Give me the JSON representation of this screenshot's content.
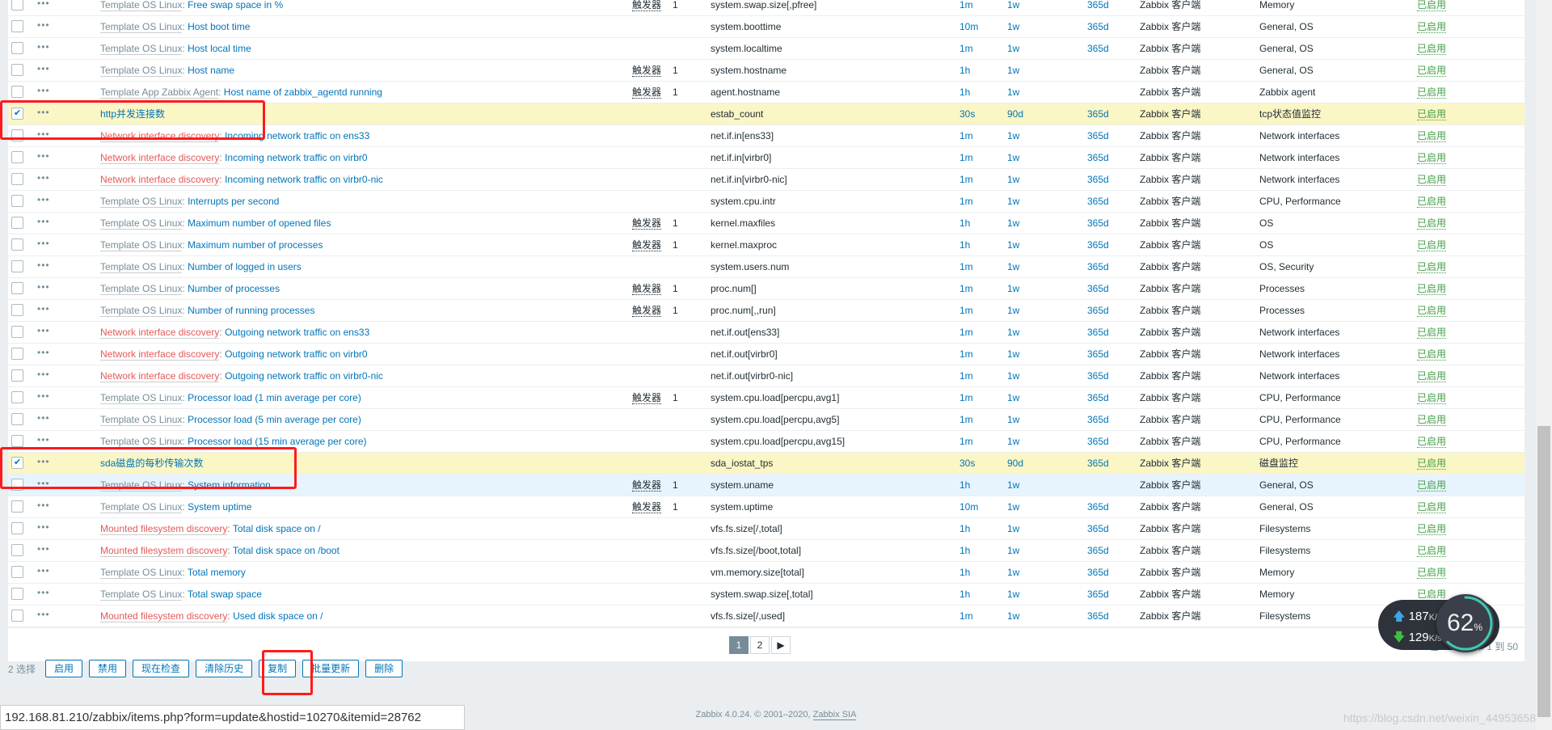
{
  "trigger_label": "触发器",
  "rows": [
    {
      "prefix": "Template OS Linux",
      "prefix_color": "gray",
      "name": "Free swap space in %",
      "triggers": "1",
      "key": "system.swap.size[,pfree]",
      "interval": "1m",
      "history": "1w",
      "trends": "365d",
      "type": "Zabbix 客户端",
      "apps": "Memory",
      "status": "已启用"
    },
    {
      "prefix": "Template OS Linux",
      "prefix_color": "gray",
      "name": "Host boot time",
      "triggers": "",
      "key": "system.boottime",
      "interval": "10m",
      "history": "1w",
      "trends": "365d",
      "type": "Zabbix 客户端",
      "apps": "General, OS",
      "status": "已启用"
    },
    {
      "prefix": "Template OS Linux",
      "prefix_color": "gray",
      "name": "Host local time",
      "triggers": "",
      "key": "system.localtime",
      "interval": "1m",
      "history": "1w",
      "trends": "365d",
      "type": "Zabbix 客户端",
      "apps": "General, OS",
      "status": "已启用"
    },
    {
      "prefix": "Template OS Linux",
      "prefix_color": "gray",
      "name": "Host name",
      "triggers": "1",
      "key": "system.hostname",
      "interval": "1h",
      "history": "1w",
      "trends": "",
      "type": "Zabbix 客户端",
      "apps": "General, OS",
      "status": "已启用"
    },
    {
      "prefix": "Template App Zabbix Agent",
      "prefix_color": "gray",
      "name": "Host name of zabbix_agentd running",
      "triggers": "1",
      "key": "agent.hostname",
      "interval": "1h",
      "history": "1w",
      "trends": "",
      "type": "Zabbix 客户端",
      "apps": "Zabbix agent",
      "status": "已启用"
    },
    {
      "prefix": "",
      "prefix_color": "",
      "name": "http并发连接数",
      "triggers": "",
      "key": "estab_count",
      "interval": "30s",
      "history": "90d",
      "trends": "365d",
      "type": "Zabbix 客户端",
      "apps": "tcp状态值监控",
      "status": "已启用",
      "checked": true
    },
    {
      "prefix": "Network interface discovery",
      "prefix_color": "red",
      "name": "Incoming network traffic on ens33",
      "triggers": "",
      "key": "net.if.in[ens33]",
      "interval": "1m",
      "history": "1w",
      "trends": "365d",
      "type": "Zabbix 客户端",
      "apps": "Network interfaces",
      "status": "已启用"
    },
    {
      "prefix": "Network interface discovery",
      "prefix_color": "red",
      "name": "Incoming network traffic on virbr0",
      "triggers": "",
      "key": "net.if.in[virbr0]",
      "interval": "1m",
      "history": "1w",
      "trends": "365d",
      "type": "Zabbix 客户端",
      "apps": "Network interfaces",
      "status": "已启用"
    },
    {
      "prefix": "Network interface discovery",
      "prefix_color": "red",
      "name": "Incoming network traffic on virbr0-nic",
      "triggers": "",
      "key": "net.if.in[virbr0-nic]",
      "interval": "1m",
      "history": "1w",
      "trends": "365d",
      "type": "Zabbix 客户端",
      "apps": "Network interfaces",
      "status": "已启用"
    },
    {
      "prefix": "Template OS Linux",
      "prefix_color": "gray",
      "name": "Interrupts per second",
      "triggers": "",
      "key": "system.cpu.intr",
      "interval": "1m",
      "history": "1w",
      "trends": "365d",
      "type": "Zabbix 客户端",
      "apps": "CPU, Performance",
      "status": "已启用"
    },
    {
      "prefix": "Template OS Linux",
      "prefix_color": "gray",
      "name": "Maximum number of opened files",
      "triggers": "1",
      "key": "kernel.maxfiles",
      "interval": "1h",
      "history": "1w",
      "trends": "365d",
      "type": "Zabbix 客户端",
      "apps": "OS",
      "status": "已启用"
    },
    {
      "prefix": "Template OS Linux",
      "prefix_color": "gray",
      "name": "Maximum number of processes",
      "triggers": "1",
      "key": "kernel.maxproc",
      "interval": "1h",
      "history": "1w",
      "trends": "365d",
      "type": "Zabbix 客户端",
      "apps": "OS",
      "status": "已启用"
    },
    {
      "prefix": "Template OS Linux",
      "prefix_color": "gray",
      "name": "Number of logged in users",
      "triggers": "",
      "key": "system.users.num",
      "interval": "1m",
      "history": "1w",
      "trends": "365d",
      "type": "Zabbix 客户端",
      "apps": "OS, Security",
      "status": "已启用"
    },
    {
      "prefix": "Template OS Linux",
      "prefix_color": "gray",
      "name": "Number of processes",
      "triggers": "1",
      "key": "proc.num[]",
      "interval": "1m",
      "history": "1w",
      "trends": "365d",
      "type": "Zabbix 客户端",
      "apps": "Processes",
      "status": "已启用"
    },
    {
      "prefix": "Template OS Linux",
      "prefix_color": "gray",
      "name": "Number of running processes",
      "triggers": "1",
      "key": "proc.num[,,run]",
      "interval": "1m",
      "history": "1w",
      "trends": "365d",
      "type": "Zabbix 客户端",
      "apps": "Processes",
      "status": "已启用"
    },
    {
      "prefix": "Network interface discovery",
      "prefix_color": "red",
      "name": "Outgoing network traffic on ens33",
      "triggers": "",
      "key": "net.if.out[ens33]",
      "interval": "1m",
      "history": "1w",
      "trends": "365d",
      "type": "Zabbix 客户端",
      "apps": "Network interfaces",
      "status": "已启用"
    },
    {
      "prefix": "Network interface discovery",
      "prefix_color": "red",
      "name": "Outgoing network traffic on virbr0",
      "triggers": "",
      "key": "net.if.out[virbr0]",
      "interval": "1m",
      "history": "1w",
      "trends": "365d",
      "type": "Zabbix 客户端",
      "apps": "Network interfaces",
      "status": "已启用"
    },
    {
      "prefix": "Network interface discovery",
      "prefix_color": "red",
      "name": "Outgoing network traffic on virbr0-nic",
      "triggers": "",
      "key": "net.if.out[virbr0-nic]",
      "interval": "1m",
      "history": "1w",
      "trends": "365d",
      "type": "Zabbix 客户端",
      "apps": "Network interfaces",
      "status": "已启用"
    },
    {
      "prefix": "Template OS Linux",
      "prefix_color": "gray",
      "name": "Processor load (1 min average per core)",
      "triggers": "1",
      "key": "system.cpu.load[percpu,avg1]",
      "interval": "1m",
      "history": "1w",
      "trends": "365d",
      "type": "Zabbix 客户端",
      "apps": "CPU, Performance",
      "status": "已启用"
    },
    {
      "prefix": "Template OS Linux",
      "prefix_color": "gray",
      "name": "Processor load (5 min average per core)",
      "triggers": "",
      "key": "system.cpu.load[percpu,avg5]",
      "interval": "1m",
      "history": "1w",
      "trends": "365d",
      "type": "Zabbix 客户端",
      "apps": "CPU, Performance",
      "status": "已启用"
    },
    {
      "prefix": "Template OS Linux",
      "prefix_color": "gray",
      "name": "Processor load (15 min average per core)",
      "triggers": "",
      "key": "system.cpu.load[percpu,avg15]",
      "interval": "1m",
      "history": "1w",
      "trends": "365d",
      "type": "Zabbix 客户端",
      "apps": "CPU, Performance",
      "status": "已启用"
    },
    {
      "prefix": "",
      "prefix_color": "",
      "name": "sda磁盘的每秒传输次数",
      "triggers": "",
      "key": "sda_iostat_tps",
      "interval": "30s",
      "history": "90d",
      "trends": "365d",
      "type": "Zabbix 客户端",
      "apps": "磁盘监控",
      "status": "已启用",
      "checked": true
    },
    {
      "prefix": "Template OS Linux",
      "prefix_color": "gray",
      "name": "System information",
      "triggers": "1",
      "key": "system.uname",
      "interval": "1h",
      "history": "1w",
      "trends": "",
      "type": "Zabbix 客户端",
      "apps": "General, OS",
      "status": "已启用",
      "hover": true
    },
    {
      "prefix": "Template OS Linux",
      "prefix_color": "gray",
      "name": "System uptime",
      "triggers": "1",
      "key": "system.uptime",
      "interval": "10m",
      "history": "1w",
      "trends": "365d",
      "type": "Zabbix 客户端",
      "apps": "General, OS",
      "status": "已启用"
    },
    {
      "prefix": "Mounted filesystem discovery",
      "prefix_color": "red",
      "name": "Total disk space on /",
      "triggers": "",
      "key": "vfs.fs.size[/,total]",
      "interval": "1h",
      "history": "1w",
      "trends": "365d",
      "type": "Zabbix 客户端",
      "apps": "Filesystems",
      "status": "已启用"
    },
    {
      "prefix": "Mounted filesystem discovery",
      "prefix_color": "red",
      "name": "Total disk space on /boot",
      "triggers": "",
      "key": "vfs.fs.size[/boot,total]",
      "interval": "1h",
      "history": "1w",
      "trends": "365d",
      "type": "Zabbix 客户端",
      "apps": "Filesystems",
      "status": "已启用"
    },
    {
      "prefix": "Template OS Linux",
      "prefix_color": "gray",
      "name": "Total memory",
      "triggers": "",
      "key": "vm.memory.size[total]",
      "interval": "1h",
      "history": "1w",
      "trends": "365d",
      "type": "Zabbix 客户端",
      "apps": "Memory",
      "status": "已启用"
    },
    {
      "prefix": "Template OS Linux",
      "prefix_color": "gray",
      "name": "Total swap space",
      "triggers": "",
      "key": "system.swap.size[,total]",
      "interval": "1h",
      "history": "1w",
      "trends": "365d",
      "type": "Zabbix 客户端",
      "apps": "Memory",
      "status": "已启用"
    },
    {
      "prefix": "Mounted filesystem discovery",
      "prefix_color": "red",
      "name": "Used disk space on /",
      "triggers": "",
      "key": "vfs.fs.size[/,used]",
      "interval": "1m",
      "history": "1w",
      "trends": "365d",
      "type": "Zabbix 客户端",
      "apps": "Filesystems",
      "status": "已启用"
    }
  ],
  "pagination": {
    "pages": [
      "1",
      "2"
    ],
    "current": "1",
    "next_icon": "triangle-right-icon",
    "info": "在 52 中打印 1 到 50"
  },
  "actions": {
    "selected": "2 选择",
    "buttons": [
      "启用",
      "禁用",
      "现在检查",
      "清除历史",
      "复制",
      "批量更新",
      "删除"
    ]
  },
  "footer": {
    "text": "Zabbix 4.0.24. © 2001–2020, ",
    "link": "Zabbix SIA"
  },
  "status_bar": "192.168.81.210/zabbix/items.php?form=update&hostid=10270&itemid=28762",
  "watermark": "https://blog.csdn.net/weixin_44953658",
  "net_widget": {
    "upload": "187",
    "download": "129",
    "unit": "K/s",
    "percent": "62",
    "percent_sign": "%"
  },
  "colors": {
    "link": "#0275b8",
    "discovery_prefix": "#e45959",
    "enabled": "#429e47",
    "selected_row": "#fbf6c6",
    "annotation": "#ff1a1a"
  }
}
